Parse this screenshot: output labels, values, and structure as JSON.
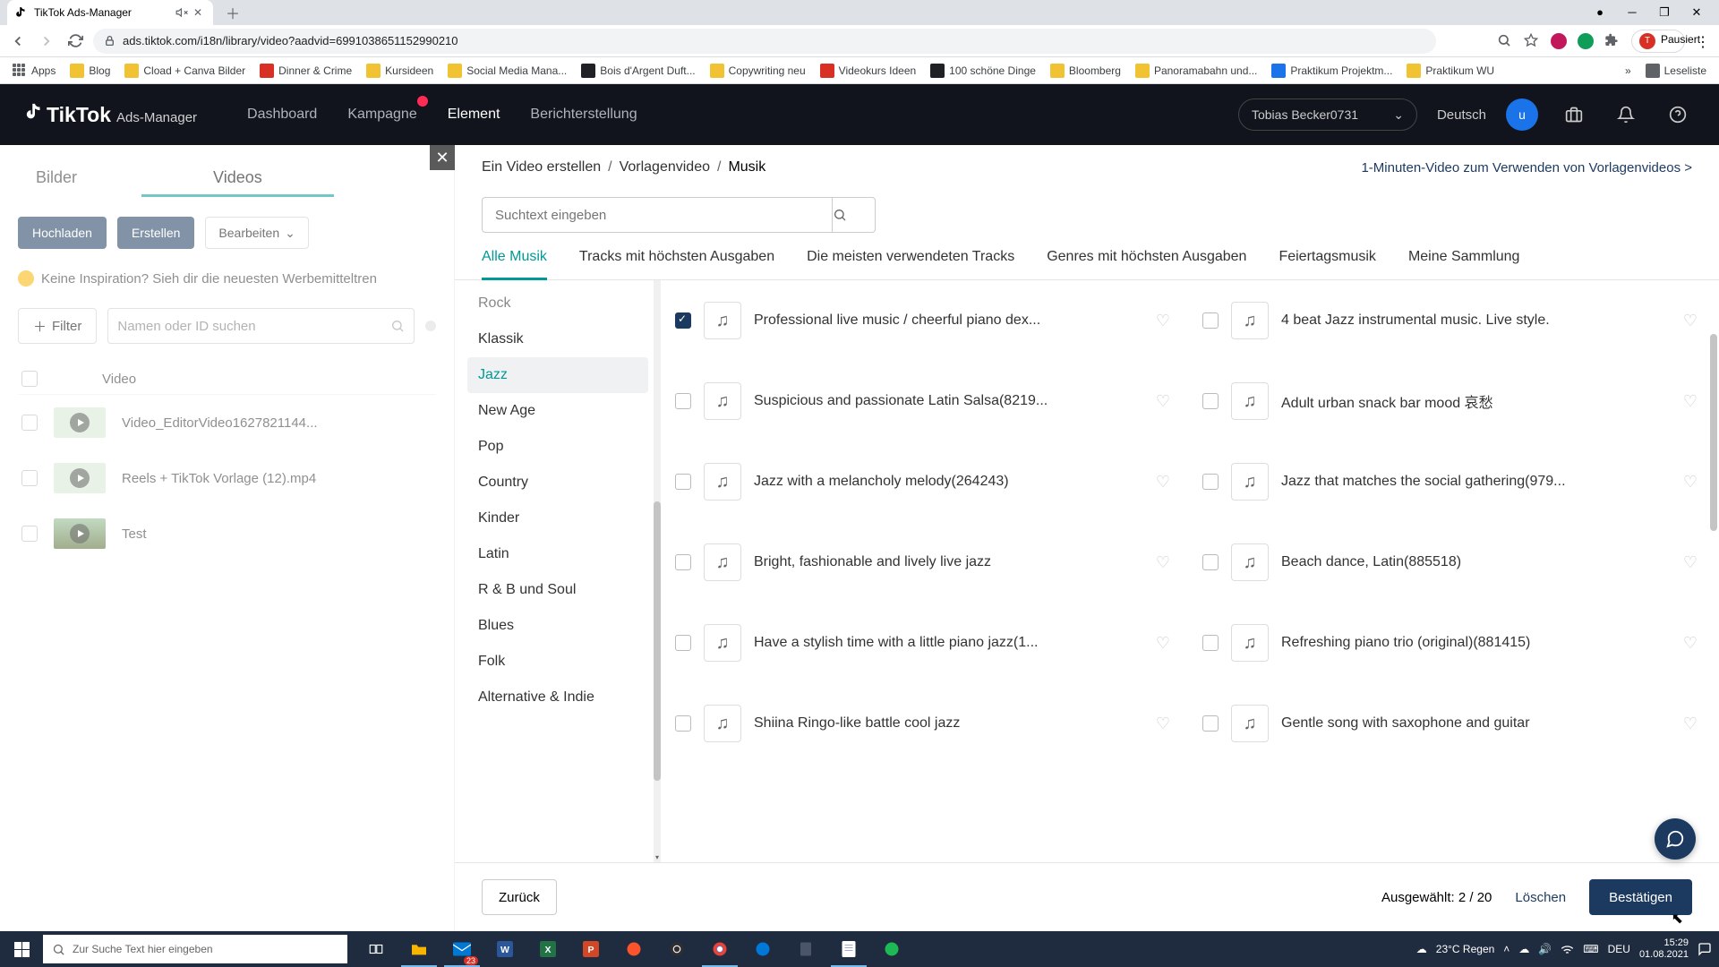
{
  "browser": {
    "tab_title": "TikTok Ads-Manager",
    "url": "ads.tiktok.com/i18n/library/video?aadvid=6991038651152990210",
    "profile_status": "Pausiert",
    "bookmarks": [
      "Apps",
      "Blog",
      "Cload + Canva Bilder",
      "Dinner & Crime",
      "Kursideen",
      "Social Media Mana...",
      "Bois d'Argent Duft...",
      "Copywriting neu",
      "Videokurs Ideen",
      "100 schöne Dinge",
      "Bloomberg",
      "Panoramabahn und...",
      "Praktikum Projektm...",
      "Praktikum WU"
    ],
    "more": "»",
    "leseliste": "Leseliste"
  },
  "header": {
    "logo_main": "TikTok",
    "logo_sub": "Ads-Manager",
    "nav": [
      "Dashboard",
      "Kampagne",
      "Element",
      "Berichterstellung"
    ],
    "account": "Tobias Becker0731",
    "language": "Deutsch",
    "user_initial": "u"
  },
  "left": {
    "tabs": [
      "Bilder",
      "Videos"
    ],
    "hochladen": "Hochladen",
    "erstellen": "Erstellen",
    "bearbeiten": "Bearbeiten",
    "inspiration": "Keine Inspiration? Sieh dir die neuesten Werbemitteltren",
    "filter": "Filter",
    "search_placeholder": "Namen oder ID suchen",
    "col_video": "Video",
    "videos": [
      {
        "name": "Video_EditorVideo1627821144..."
      },
      {
        "name": "Reels + TikTok Vorlage (12).mp4"
      },
      {
        "name": "Test"
      }
    ]
  },
  "right": {
    "breadcrumb": [
      "Ein Video erstellen",
      "Vorlagenvideo",
      "Musik"
    ],
    "help_link": "1-Minuten-Video zum Verwenden von Vorlagenvideos >",
    "search_placeholder": "Suchtext eingeben",
    "tabs": [
      "Alle Musik",
      "Tracks mit höchsten Ausgaben",
      "Die meisten verwendeten Tracks",
      "Genres mit höchsten Ausgaben",
      "Feiertagsmusik",
      "Meine Sammlung"
    ],
    "genres": [
      "Rock",
      "Klassik",
      "Jazz",
      "New Age",
      "Pop",
      "Country",
      "Kinder",
      "Latin",
      "R & B und Soul",
      "Blues",
      "Folk",
      "Alternative & Indie"
    ],
    "tracks": [
      {
        "title": "Professional live music / cheerful piano dex...",
        "checked": true
      },
      {
        "title": "4 beat Jazz instrumental music. Live style.",
        "checked": false
      },
      {
        "title": "Suspicious and passionate Latin Salsa(8219...",
        "checked": false
      },
      {
        "title": "Adult urban snack bar mood 哀愁",
        "checked": false
      },
      {
        "title": "Jazz with a melancholy melody(264243)",
        "checked": false
      },
      {
        "title": "Jazz that matches the social gathering(979...",
        "checked": false
      },
      {
        "title": "Bright, fashionable and lively live jazz",
        "checked": false
      },
      {
        "title": "Beach dance, Latin(885518)",
        "checked": false
      },
      {
        "title": "Have a stylish time with a little piano jazz(1...",
        "checked": false
      },
      {
        "title": "Refreshing piano trio (original)(881415)",
        "checked": false
      },
      {
        "title": "Shiina Ringo-like battle cool jazz",
        "checked": false
      },
      {
        "title": "Gentle song with saxophone and guitar",
        "checked": false
      }
    ],
    "back": "Zurück",
    "selected_label": "Ausgewählt: 2 / 20",
    "delete": "Löschen",
    "confirm": "Bestätigen"
  },
  "taskbar": {
    "search": "Zur Suche Text hier eingeben",
    "weather": "23°C  Regen",
    "lang": "DEU",
    "time": "15:29",
    "date": "01.08.2021",
    "mail_badge": "23"
  }
}
